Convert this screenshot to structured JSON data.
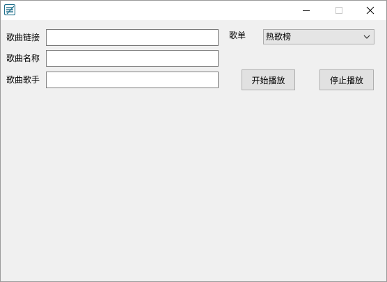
{
  "window": {
    "icon": "app-stripes-icon",
    "controls": [
      "minimize-icon",
      "maximize-icon",
      "close-icon"
    ]
  },
  "form": {
    "song_link_label": "歌曲链接",
    "song_link_value": "",
    "song_name_label": "歌曲名称",
    "song_name_value": "",
    "song_artist_label": "歌曲歌手",
    "song_artist_value": "",
    "playlist_label": "歌单",
    "playlist_selected": "热歌榜"
  },
  "buttons": {
    "start_label": "开始播放",
    "stop_label": "停止播放"
  },
  "colors": {
    "window_bg": "#f0f0f0",
    "titlebar_bg": "#ffffff",
    "icon_accent": "#1f6f8b",
    "button_bg": "#e1e1e1"
  }
}
